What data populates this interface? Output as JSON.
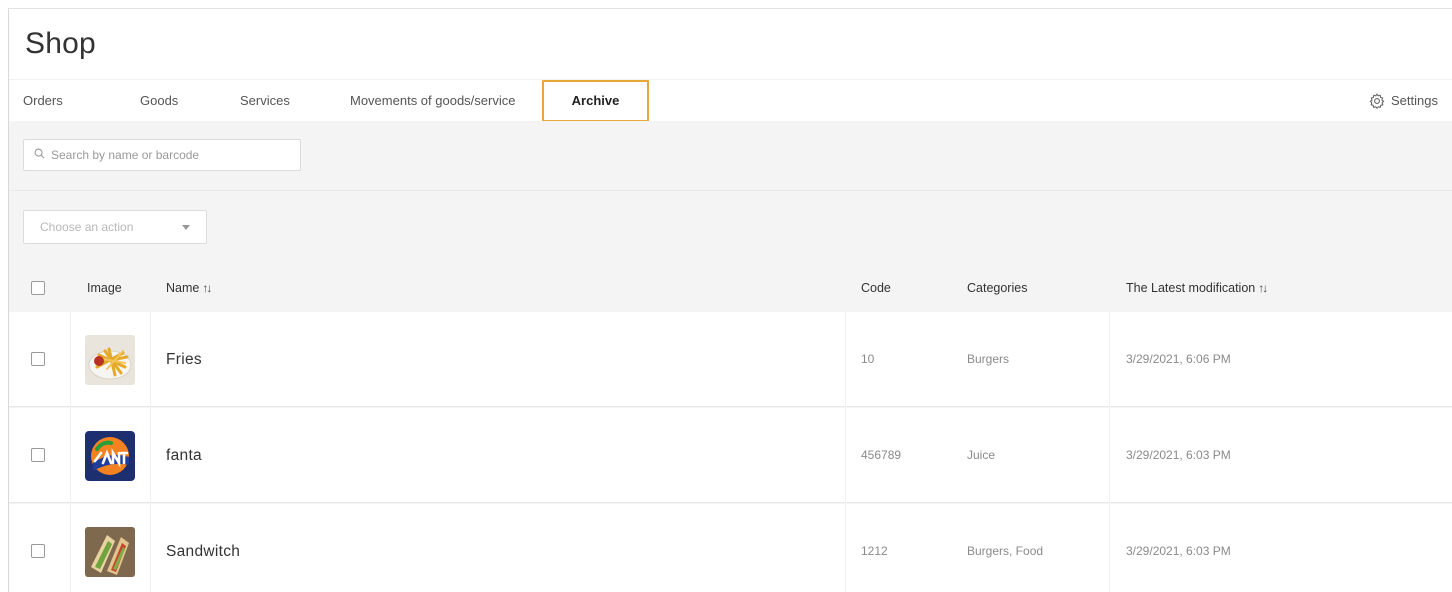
{
  "page": {
    "title": "Shop"
  },
  "tabs": [
    {
      "label": "Orders",
      "active": false
    },
    {
      "label": "Goods",
      "active": false
    },
    {
      "label": "Services",
      "active": false
    },
    {
      "label": "Movements of goods/service",
      "active": false
    },
    {
      "label": "Archive",
      "active": true
    }
  ],
  "settings": {
    "label": "Settings",
    "icon": "gear-icon"
  },
  "search": {
    "placeholder": "Search by name or barcode",
    "value": "",
    "icon": "search-icon"
  },
  "action_select": {
    "placeholder": "Choose an action",
    "icon": "chevron-down-icon"
  },
  "table": {
    "columns": {
      "image": "Image",
      "name": "Name",
      "code": "Code",
      "categories": "Categories",
      "modified": "The Latest modification"
    },
    "sort_glyph": "↑↓",
    "rows": [
      {
        "name": "Fries",
        "code": "10",
        "categories": "Burgers",
        "modified": "3/29/2021, 6:06 PM",
        "image": "fries-thumbnail"
      },
      {
        "name": "fanta",
        "code": "456789",
        "categories": "Juice",
        "modified": "3/29/2021, 6:03 PM",
        "image": "fanta-thumbnail"
      },
      {
        "name": "Sandwitch",
        "code": "1212",
        "categories": "Burgers, Food",
        "modified": "3/29/2021, 6:03 PM",
        "image": "sandwich-thumbnail"
      }
    ]
  },
  "colors": {
    "active_tab_highlight": "#e8a838",
    "background": "#f4f4f4"
  }
}
